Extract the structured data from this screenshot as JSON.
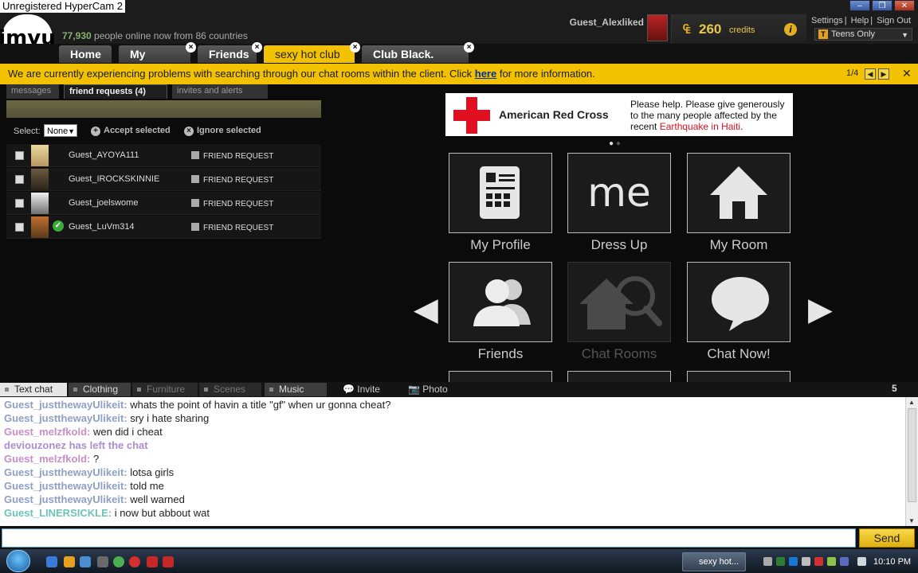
{
  "recorder_label": "Unregistered HyperCam 2",
  "header": {
    "logo_text": "imvu",
    "online_count": "77,930",
    "online_text": " people online now from 86 countries",
    "username": "Guest_Alexliked",
    "credits_amount": "260",
    "credits_label": "credits",
    "credits_symbol": "₠",
    "links": [
      "Settings",
      "Help",
      "Sign Out"
    ],
    "age_filter": "Teens Only",
    "window_buttons": [
      "–",
      "❐",
      "✕"
    ]
  },
  "tabs": [
    {
      "label": "Home",
      "closable": false,
      "active": false
    },
    {
      "label": "My Room",
      "closable": true,
      "active": false
    },
    {
      "label": "Friends",
      "closable": true,
      "active": false
    },
    {
      "label": "sexy hot club",
      "closable": true,
      "active": true
    },
    {
      "label": "Club Black. [ni...",
      "closable": true,
      "active": false
    }
  ],
  "banner": {
    "text_before": "We are currently experiencing problems with searching through our chat rooms within the client. Click ",
    "link": "here",
    "text_after": " for more information.",
    "page": "1/4"
  },
  "friend_panel": {
    "subtabs": [
      "messages",
      "friend requests (4)",
      "invites and alerts"
    ],
    "select_label": "Select:",
    "select_value": "None",
    "accept_label": "Accept selected",
    "ignore_label": "Ignore selected",
    "requests": [
      {
        "name": "Guest_AYOYA111",
        "status": "FRIEND REQUEST",
        "verified": false
      },
      {
        "name": "Guest_IROCKSKINNIE",
        "status": "FRIEND REQUEST",
        "verified": false
      },
      {
        "name": "Guest_joelswome",
        "status": "FRIEND REQUEST",
        "verified": false
      },
      {
        "name": "Guest_LuVm314",
        "status": "FRIEND REQUEST",
        "verified": true
      }
    ]
  },
  "ad": {
    "brand": "American Red Cross",
    "message_before": "Please help. Please give generously to the many people affected by the recent ",
    "message_highlight": "Earthquake in Haiti",
    "message_after": ".",
    "dots": "●",
    "dots_inactive": " ●"
  },
  "grid": [
    {
      "label": "My Profile",
      "icon": "profile-icon",
      "dim": false
    },
    {
      "label": "Dress Up",
      "icon": "me-icon",
      "dim": false
    },
    {
      "label": "My Room",
      "icon": "house-icon",
      "dim": false
    },
    {
      "label": "Friends",
      "icon": "people-icon",
      "dim": false
    },
    {
      "label": "Chat Rooms",
      "icon": "chat-rooms-icon",
      "dim": true
    },
    {
      "label": "Chat Now!",
      "icon": "speech-bubble-icon",
      "dim": false
    }
  ],
  "chat_tabs": [
    "Text chat",
    "Clothing",
    "Furniture",
    "Scenes",
    "Music"
  ],
  "chat_actions": [
    "Invite",
    "Photo"
  ],
  "chat_user_count": "5",
  "chat_messages": [
    {
      "user": "Guest_justthewayUlikeit:",
      "text": " whats the point of havin a title \"gf\" when ur gonna cheat?",
      "color": "#8ea0c8"
    },
    {
      "user": "Guest_justthewayUlikeit:",
      "text": " sry i hate sharing",
      "color": "#8ea0c8"
    },
    {
      "user": "Guest_melzfkold:",
      "text": " wen did i cheat",
      "color": "#c98fc9"
    },
    {
      "user": "deviouzonez has left the chat",
      "text": "",
      "color": "#a98fd0"
    },
    {
      "user": "Guest_melzfkold:",
      "text": " ?",
      "color": "#c98fc9"
    },
    {
      "user": "Guest_justthewayUlikeit:",
      "text": " lotsa girls",
      "color": "#8ea0c8"
    },
    {
      "user": "Guest_justthewayUlikeit:",
      "text": " told me",
      "color": "#8ea0c8"
    },
    {
      "user": "Guest_justthewayUlikeit:",
      "text": " well warned",
      "color": "#8ea0c8"
    },
    {
      "user": "Guest_LINERSICKLE:",
      "text": " i now but abbout wat",
      "color": "#6cc4b8"
    }
  ],
  "input": {
    "value": "",
    "send_label": "Send"
  },
  "taskbar": {
    "item_label": "sexy hot...",
    "clock": "10:10 PM"
  }
}
